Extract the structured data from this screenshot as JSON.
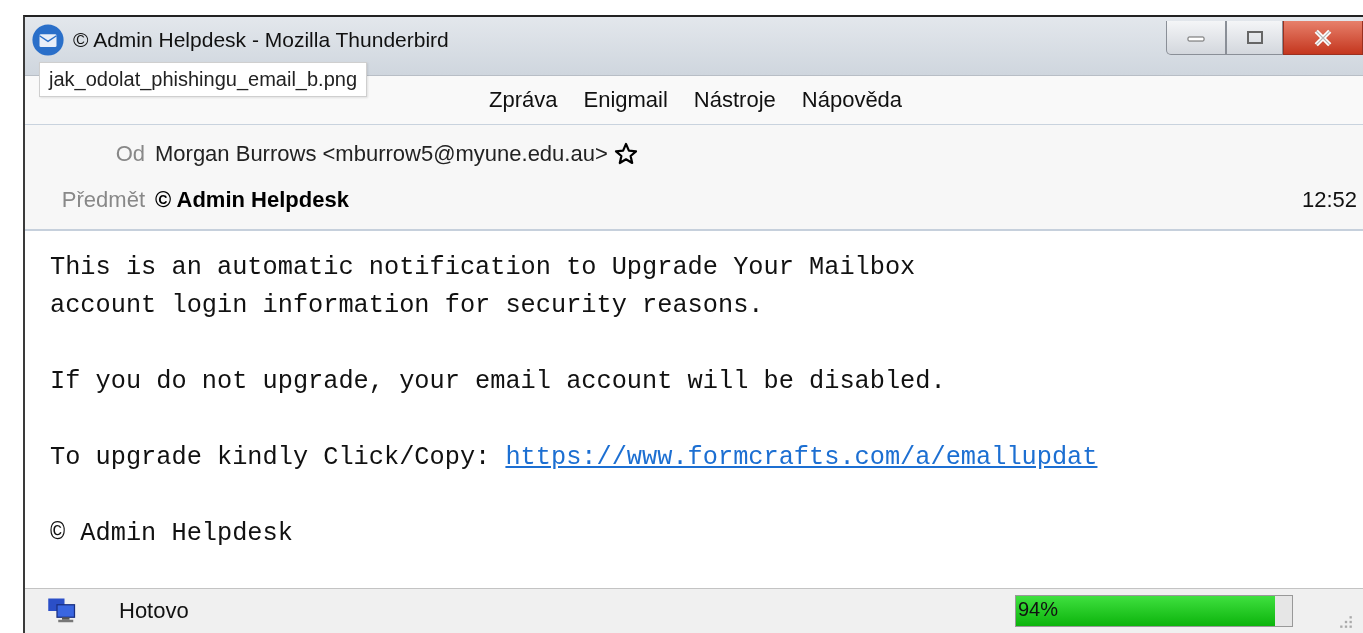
{
  "window": {
    "title": "© Admin Helpdesk - Mozilla Thunderbird"
  },
  "tooltip": "jak_odolat_phishingu_email_b.png",
  "menu": [
    {
      "label": "Zpráva"
    },
    {
      "label": "Enigmail"
    },
    {
      "label": "Nástroje"
    },
    {
      "label": "Nápověda"
    }
  ],
  "header": {
    "from_label": "Od",
    "from": "Morgan Burrows <mburrow5@myune.edu.au>",
    "starred": false,
    "subject_label": "Předmět",
    "subject": "© Admin Helpdesk",
    "time": "12:52"
  },
  "body": [
    {
      "kind": "text",
      "text": "This is an automatic notification to Upgrade Your Mailbox\naccount login information for security reasons."
    },
    {
      "kind": "text",
      "text": "If you do not upgrade, your email account will be disabled."
    },
    {
      "kind": "link",
      "text": "To upgrade kindly Click/Copy: ",
      "link": "https://www.formcrafts.com/a/emallupdat"
    },
    {
      "kind": "text",
      "text": "© Admin Helpdesk"
    }
  ],
  "status_bar": {
    "text": "Hotovo",
    "progress": {
      "level": 0.94,
      "reading": "94%"
    }
  }
}
